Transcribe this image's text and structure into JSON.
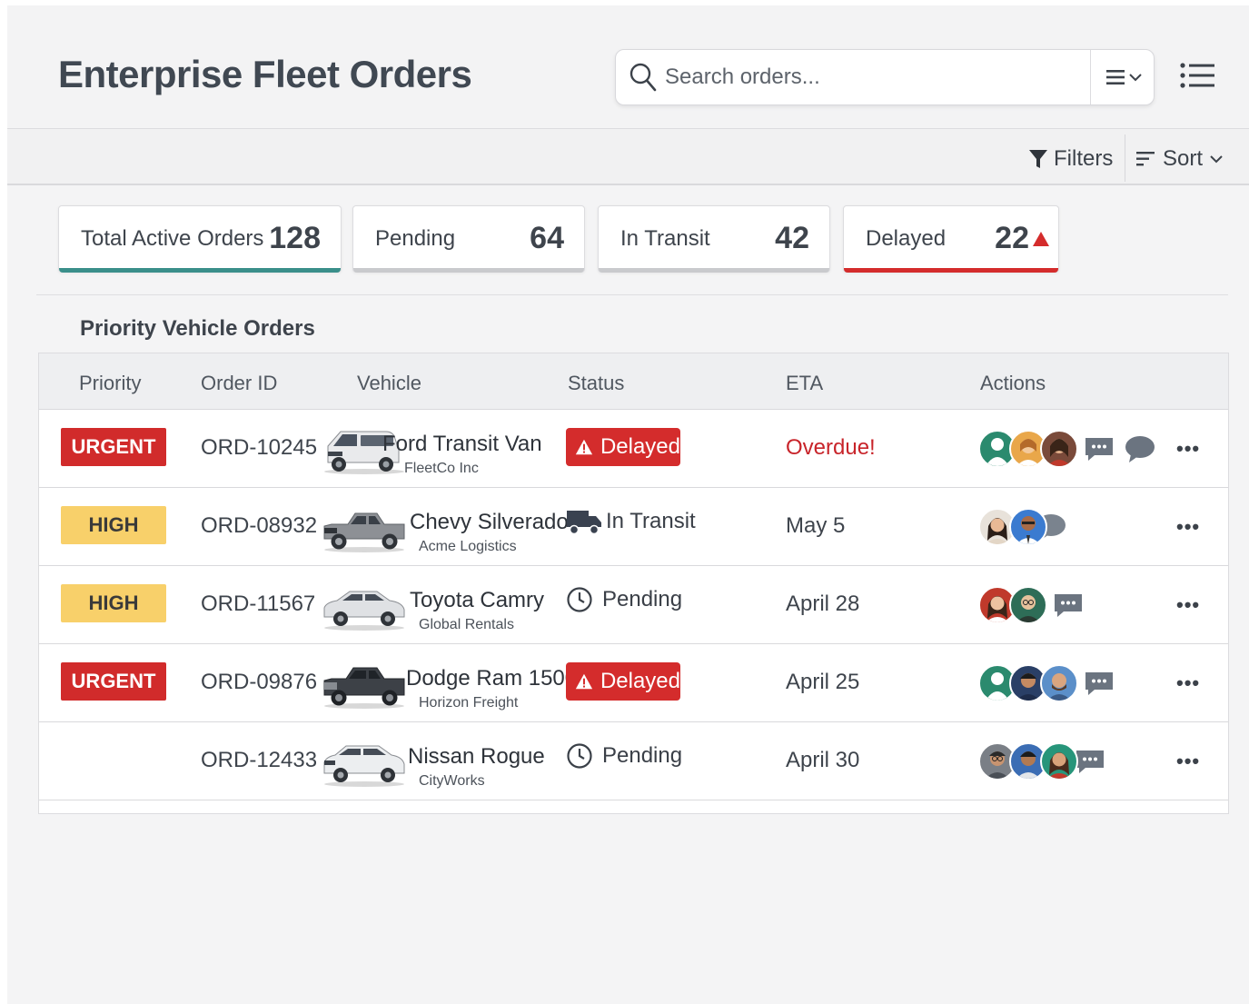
{
  "header": {
    "title": "Enterprise Fleet Orders",
    "search_placeholder": "Search orders...",
    "view_toggle_icon": "list-view-icon",
    "menu_icon": "list-menu-icon"
  },
  "toolbar": {
    "filters_label": "Filters",
    "sort_label": "Sort"
  },
  "stats": [
    {
      "label": "Total Active Orders",
      "value": "128",
      "underline_color": "#3a8f8a"
    },
    {
      "label": "Pending",
      "value": "64",
      "underline_color": "#c9cacd"
    },
    {
      "label": "In Transit",
      "value": "42",
      "underline_color": "#c9cacd"
    },
    {
      "label": "Delayed",
      "value": "22",
      "underline_color": "#d42c2c",
      "alert_icon": "warning-triangle-icon"
    }
  ],
  "section_title": "Priority Vehicle Orders",
  "table": {
    "columns": [
      "Priority",
      "Order ID",
      "Vehicle",
      "Status",
      "ETA",
      "Actions"
    ],
    "rows": [
      {
        "priority": "URGENT",
        "order_id": "ORD-10245",
        "vehicle": "Ford Transit Van",
        "company": "FleetCo Inc",
        "status": "Delayed",
        "eta": "Overdue!"
      },
      {
        "priority": "HIGH",
        "order_id": "ORD-08932",
        "vehicle": "Chevy Silverado",
        "company": "Acme Logistics",
        "status": "In Transit",
        "eta": "May 5"
      },
      {
        "priority": "HIGH",
        "order_id": "ORD-11567",
        "vehicle": "Toyota Camry",
        "company": "Global Rentals",
        "status": "Pending",
        "eta": "April 28"
      },
      {
        "priority": "URGENT",
        "order_id": "ORD-09876",
        "vehicle": "Dodge Ram 1500",
        "company": "Horizon Freight",
        "status": "Delayed",
        "eta": "April 25"
      },
      {
        "priority": "",
        "order_id": "ORD-12433",
        "vehicle": "Nissan Rogue",
        "company": "CityWorks",
        "status": "Pending",
        "eta": "April 30"
      }
    ],
    "more_label": "•••"
  },
  "colors": {
    "urgent": "#d12b2b",
    "high": "#f8d06a",
    "delayed": "#d42c2c",
    "accent_teal": "#3a8f8a"
  }
}
